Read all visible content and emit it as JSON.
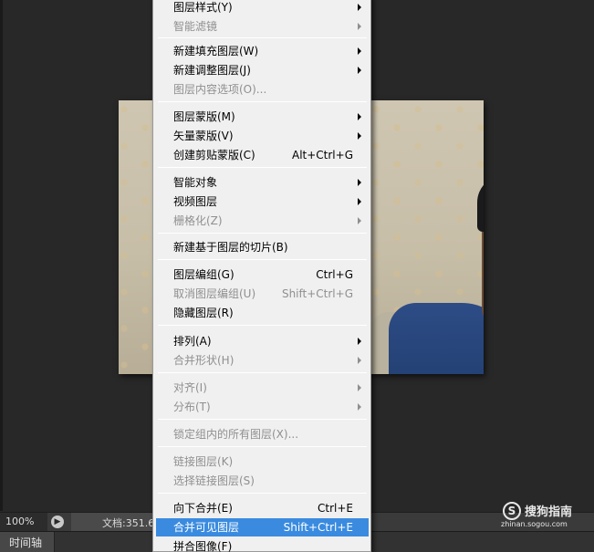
{
  "menu": {
    "items": [
      {
        "label": "图层样式(Y)",
        "shortcut": "",
        "submenu": true,
        "disabled": false
      },
      {
        "label": "智能滤镜",
        "shortcut": "",
        "submenu": true,
        "disabled": true
      },
      {
        "label": "新建填充图层(W)",
        "shortcut": "",
        "submenu": true,
        "disabled": false
      },
      {
        "label": "新建调整图层(J)",
        "shortcut": "",
        "submenu": true,
        "disabled": false
      },
      {
        "label": "图层内容选项(O)...",
        "shortcut": "",
        "submenu": false,
        "disabled": true
      },
      {
        "label": "图层蒙版(M)",
        "shortcut": "",
        "submenu": true,
        "disabled": false
      },
      {
        "label": "矢量蒙版(V)",
        "shortcut": "",
        "submenu": true,
        "disabled": false
      },
      {
        "label": "创建剪贴蒙版(C)",
        "shortcut": "Alt+Ctrl+G",
        "submenu": false,
        "disabled": false
      },
      {
        "label": "智能对象",
        "shortcut": "",
        "submenu": true,
        "disabled": false
      },
      {
        "label": "视频图层",
        "shortcut": "",
        "submenu": true,
        "disabled": false
      },
      {
        "label": "栅格化(Z)",
        "shortcut": "",
        "submenu": true,
        "disabled": true
      },
      {
        "label": "新建基于图层的切片(B)",
        "shortcut": "",
        "submenu": false,
        "disabled": false
      },
      {
        "label": "图层编组(G)",
        "shortcut": "Ctrl+G",
        "submenu": false,
        "disabled": false
      },
      {
        "label": "取消图层编组(U)",
        "shortcut": "Shift+Ctrl+G",
        "submenu": false,
        "disabled": true
      },
      {
        "label": "隐藏图层(R)",
        "shortcut": "",
        "submenu": false,
        "disabled": false
      },
      {
        "label": "排列(A)",
        "shortcut": "",
        "submenu": true,
        "disabled": false
      },
      {
        "label": "合并形状(H)",
        "shortcut": "",
        "submenu": true,
        "disabled": true
      },
      {
        "label": "对齐(I)",
        "shortcut": "",
        "submenu": true,
        "disabled": true
      },
      {
        "label": "分布(T)",
        "shortcut": "",
        "submenu": true,
        "disabled": true
      },
      {
        "label": "锁定组内的所有图层(X)...",
        "shortcut": "",
        "submenu": false,
        "disabled": true
      },
      {
        "label": "链接图层(K)",
        "shortcut": "",
        "submenu": false,
        "disabled": true
      },
      {
        "label": "选择链接图层(S)",
        "shortcut": "",
        "submenu": false,
        "disabled": true
      },
      {
        "label": "向下合并(E)",
        "shortcut": "Ctrl+E",
        "submenu": false,
        "disabled": false
      },
      {
        "label": "合并可见图层",
        "shortcut": "Shift+Ctrl+E",
        "submenu": false,
        "disabled": false,
        "highlighted": true
      },
      {
        "label": "拼合图像(F)",
        "shortcut": "",
        "submenu": false,
        "disabled": false
      }
    ]
  },
  "status_bar": {
    "zoom": "100%",
    "doc_info": "文档:351.6"
  },
  "bottom_tabs": {
    "timeline": "时间轴"
  },
  "watermark": {
    "logo_glyph": "S",
    "brand": "搜狗指南",
    "domain": "zhinan.sogou.com"
  },
  "colors": {
    "menu_highlight": "#3a8bdf",
    "workspace": "#282828"
  }
}
